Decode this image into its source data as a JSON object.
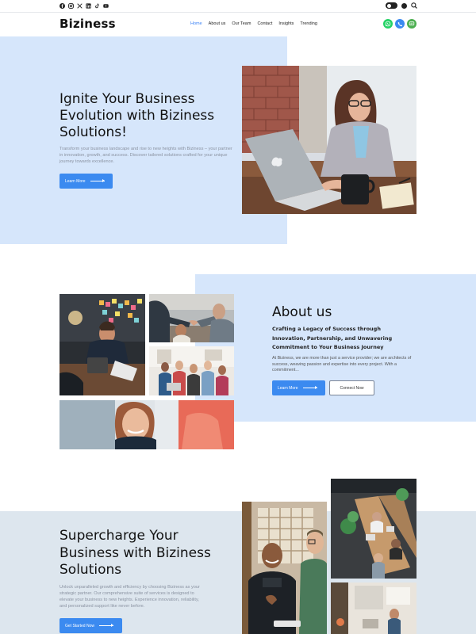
{
  "topbar": {
    "social_icons": [
      "facebook-icon",
      "instagram-icon",
      "x-icon",
      "linkedin-icon",
      "tiktok-icon",
      "youtube-icon"
    ],
    "right_icons": [
      "theme-toggle",
      "settings-icon",
      "search-icon"
    ]
  },
  "navbar": {
    "logo": "Biziness",
    "items": [
      "Home",
      "About us",
      "Our Team",
      "Contact",
      "Insights",
      "Trending"
    ],
    "active_item": "Home",
    "contact_icons": [
      "whatsapp-icon",
      "phone-icon",
      "message-icon"
    ]
  },
  "hero": {
    "title": "Ignite Your Business Evolution with Biziness Solutions!",
    "description": "Transform your business landscape and rise to new heights with Biziness – your partner in innovation, growth, and success. Discover tailored solutions crafted for your unique journey towards excellence.",
    "button_label": "Learn More"
  },
  "about": {
    "title": "About us",
    "subtitle": "Crafting a Legacy of Success through Innovation, Partnership, and Unwavering Commitment to Your Business Journey",
    "description": "At Biziness, we are more than just a service provider; we are architects of success, weaving passion and expertise into every project. With a commitment...",
    "primary_button": "Learn More",
    "secondary_button": "Connect Now"
  },
  "supercharge": {
    "title": "Supercharge Your Business with Biziness Solutions",
    "description": "Unlock unparalleled growth and efficiency by choosing Biziness as your strategic partner. Our comprehensive suite of services is designed to elevate your business to new heights. Experience innovation, reliability, and personalized support like never before.",
    "button_label": "Get Started Now"
  },
  "colors": {
    "accent": "#3b8af0",
    "active_nav": "#3b82f6",
    "hero_bg": "#d6e6fb",
    "lower_bg": "#dde6ee",
    "whatsapp": "#25d366",
    "phone": "#3b8af0",
    "message": "#4caf50"
  }
}
